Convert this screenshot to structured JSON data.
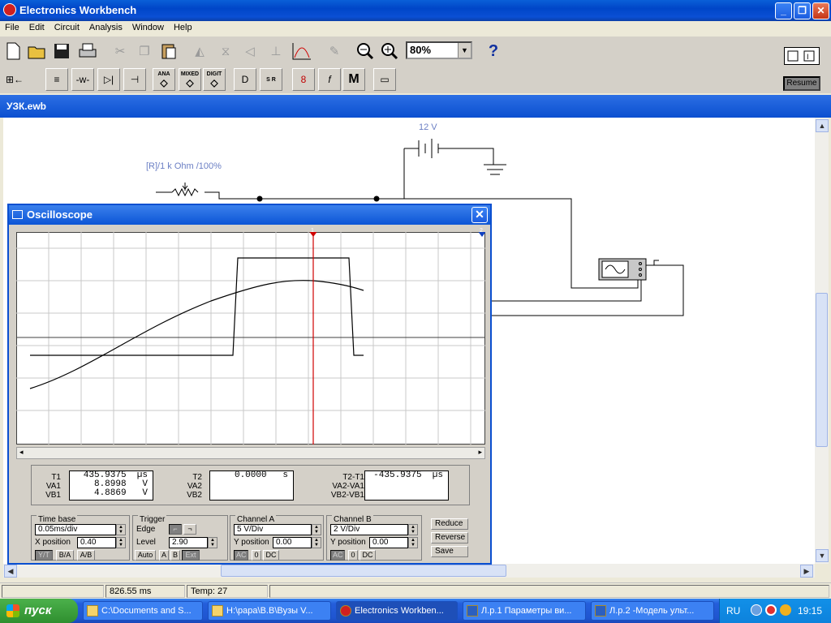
{
  "app": {
    "title": "Electronics Workbench"
  },
  "window_buttons": {
    "minimize": "_",
    "restore": "❐",
    "close": "✕"
  },
  "menu": [
    "File",
    "Edit",
    "Circuit",
    "Analysis",
    "Window",
    "Help"
  ],
  "toolbar": {
    "zoom_value": "80%",
    "help_label": "?",
    "resume_label": "Resume",
    "parts_bins": [
      {
        "icon": "sources-bin-icon",
        "label": "≡"
      },
      {
        "icon": "basic-bin-icon",
        "label": "-w-"
      },
      {
        "icon": "diodes-bin-icon",
        "label": "▷|"
      },
      {
        "icon": "transistors-bin-icon",
        "label": "⊣"
      },
      {
        "icon": "analog-ics-bin-icon",
        "label": "ANA"
      },
      {
        "icon": "mixed-ics-bin-icon",
        "label": "MIXED"
      },
      {
        "icon": "digital-ics-bin-icon",
        "label": "DIGIT"
      },
      {
        "icon": "logic-gates-bin-icon",
        "label": "D"
      },
      {
        "icon": "digital-bin-icon",
        "label": "S R"
      },
      {
        "icon": "indicators-bin-icon",
        "label": "8"
      },
      {
        "icon": "controls-bin-icon",
        "label": "f"
      },
      {
        "icon": "miscellaneous-bin-icon",
        "label": "M"
      },
      {
        "icon": "instruments-bin-icon",
        "label": "▭"
      }
    ]
  },
  "document": {
    "title": "УЗК.ewb"
  },
  "circuit": {
    "battery_label": "12 V",
    "resistor_label": "[R]/1 k Ohm /100%"
  },
  "oscilloscope": {
    "title": "Oscilloscope",
    "cursor1_label": "1",
    "cursor2_label": "2",
    "readouts": {
      "t1_label": "T1",
      "va1_label": "VA1",
      "vb1_label": "VB1",
      "t1": "435.9375  µs",
      "va1": "8.8998   V",
      "vb1": "4.8869   V",
      "t2_label": "T2",
      "va2_label": "VA2",
      "vb2_label": "VB2",
      "t2": "0.0000   s",
      "va2": "",
      "vb2": "",
      "dt_label": "T2-T1",
      "dva_label": "VA2-VA1",
      "dvb_label": "VB2-VB1",
      "dt": "-435.9375  µs",
      "dva": "",
      "dvb": ""
    },
    "timebase": {
      "label": "Time base",
      "value": "0.05ms/div",
      "xpos_label": "X position",
      "xpos": "0.40",
      "modes": [
        "Y/T",
        "B/A",
        "A/B"
      ]
    },
    "trigger": {
      "label": "Trigger",
      "edge_label": "Edge",
      "level_label": "Level",
      "level": "2.90",
      "sources": [
        "Auto",
        "A",
        "B",
        "Ext"
      ]
    },
    "channel_a": {
      "label": "Channel A",
      "value": "5  V/Div",
      "ypos_label": "Y position",
      "ypos": "0.00",
      "coupling": [
        "AC",
        "0",
        "DC"
      ]
    },
    "channel_b": {
      "label": "Channel B",
      "value": "2  V/Div",
      "ypos_label": "Y position",
      "ypos": "0.00",
      "coupling": [
        "AC",
        "0",
        "DC"
      ]
    },
    "buttons": {
      "reduce": "Reduce",
      "reverse": "Reverse",
      "save": "Save"
    }
  },
  "statusbar": {
    "time": "826.55 ms",
    "temp": "Temp:  27"
  },
  "taskbar": {
    "start_label": "пуск",
    "tasks": [
      "C:\\Documents and S...",
      "H:\\papa\\В.В\\Вузы V...",
      "Electronics Workben...",
      "Л.р.1 Параметры ви...",
      "Л.р.2 -Модель ульт..."
    ],
    "lang": "RU",
    "clock": "19:15"
  }
}
